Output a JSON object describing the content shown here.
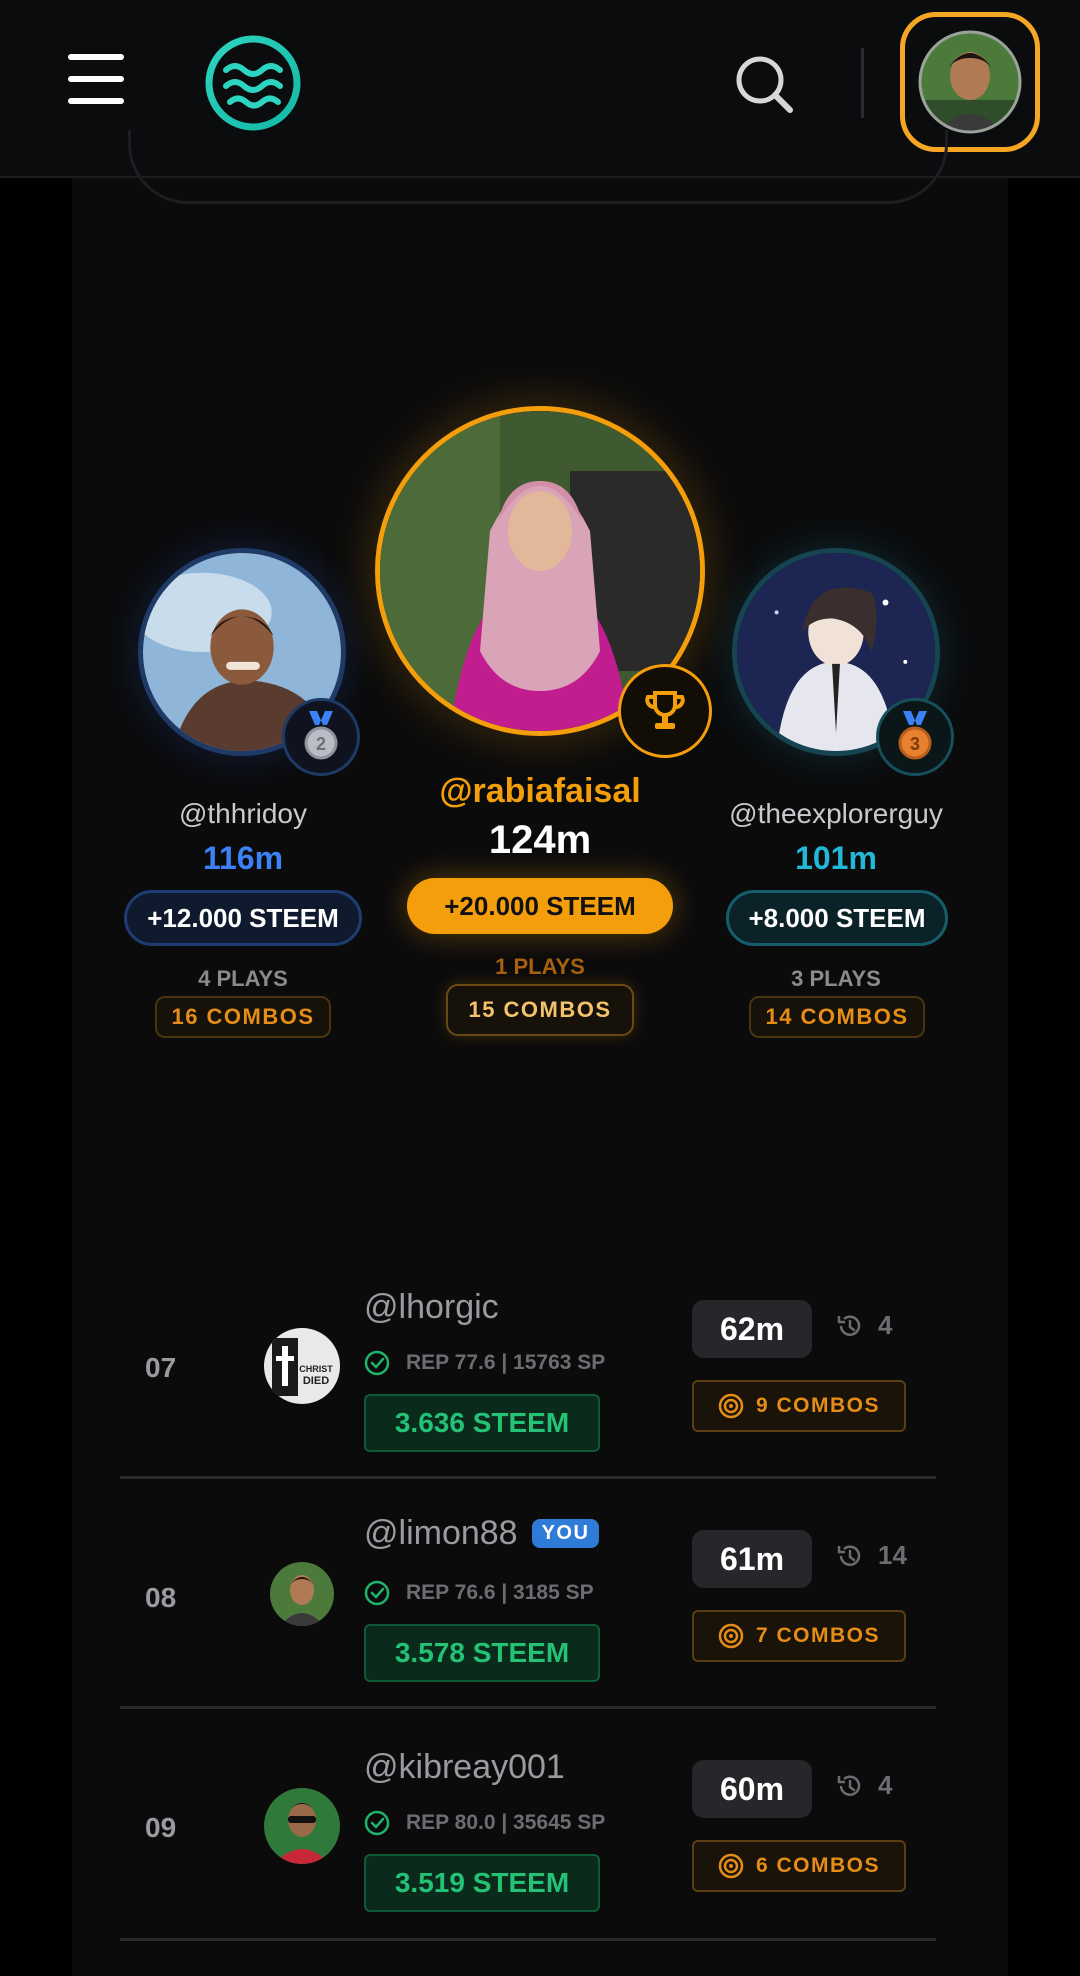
{
  "header": {
    "menu_icon": "hamburger-menu-icon",
    "logo_icon": "waves-logo-icon",
    "search_icon": "search-icon",
    "accent_color": "#f5a623"
  },
  "podium": {
    "first": {
      "username": "@rabiafaisal",
      "score": "124m",
      "reward": "+20.000 STEEM",
      "plays": "1 PLAYS",
      "combos": "15 COMBOS",
      "badge_icon": "trophy-icon",
      "color": "#f5a623"
    },
    "second": {
      "username": "@thhridoy",
      "score": "116m",
      "reward": "+12.000 STEEM",
      "plays": "4 PLAYS",
      "combos": "16 COMBOS",
      "badge_icon": "medal-2-icon",
      "badge_number": "2",
      "color": "#3b82f6"
    },
    "third": {
      "username": "@theexplorerguy",
      "score": "101m",
      "reward": "+8.000 STEEM",
      "plays": "3 PLAYS",
      "combos": "14 COMBOS",
      "badge_icon": "medal-3-icon",
      "badge_number": "3",
      "color": "#22b8d8"
    }
  },
  "rows": [
    {
      "rank": "07",
      "username": "@lhorgic",
      "is_you": false,
      "rep": "REP 77.6 | 15763 SP",
      "reward": "3.636 STEEM",
      "score": "62m",
      "plays": "4",
      "combos": "9 COMBOS"
    },
    {
      "rank": "08",
      "username": "@limon88",
      "is_you": true,
      "you_label": "YOU",
      "rep": "REP 76.6 | 3185 SP",
      "reward": "3.578 STEEM",
      "score": "61m",
      "plays": "14",
      "combos": "7 COMBOS"
    },
    {
      "rank": "09",
      "username": "@kibreay001",
      "is_you": false,
      "rep": "REP 80.0 | 35645 SP",
      "reward": "3.519 STEEM",
      "score": "60m",
      "plays": "4",
      "combos": "6 COMBOS"
    }
  ]
}
